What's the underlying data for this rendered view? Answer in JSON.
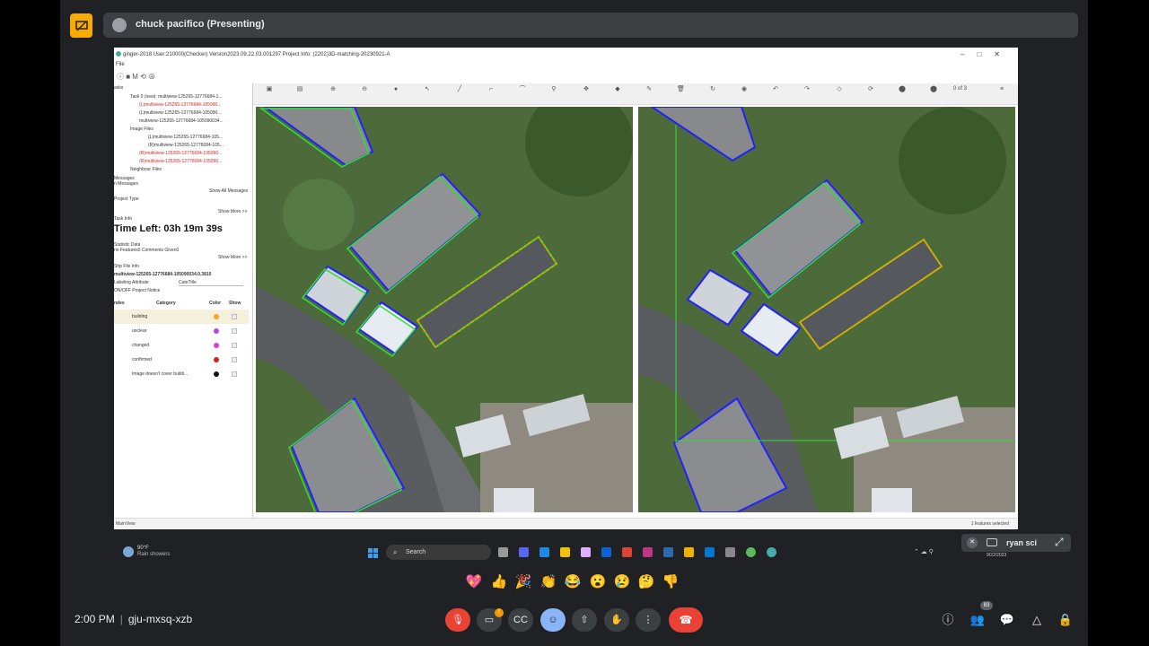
{
  "meet": {
    "presenter": "chuck pacifico (Presenting)",
    "time": "2:00 PM",
    "meeting_code": "gju-mxsq-xzb",
    "participant_count": "83",
    "pinned_participant": "ryan sci",
    "notification_count": "!",
    "reactions": [
      "💖",
      "👍",
      "🎉",
      "👏",
      "😂",
      "😮",
      "😢",
      "🤔",
      "👎"
    ]
  },
  "app": {
    "window_title": "ginger-2018   User:210000(Checker)   Version2023.09.22.03.001297   Project Info: (2202)3D-matching-20230921-A",
    "menu": "File",
    "page_count": "0 of 3",
    "status_left": "MainView",
    "status_right": "1 features selected",
    "left_panel": {
      "tasks_header": "asks",
      "task_items": [
        "Task 0 (new): multiview-125265-12776684-1...",
        "(L)multiview-125265-12776684-105090...",
        "(L)multiview-125265-12776684-105090...",
        "multiview-125265-12776684-105090034...",
        "Image Files",
        "(L)multiview-125265-12776684-105...",
        "(R)multiview-125265-12776684-105...",
        "(R)multiview-125265-12776684-105090...",
        "(R)multiview-125265-12776684-105090...",
        "Neighbour Files"
      ],
      "messages_label": "Messages",
      "messages_sub": "n Messages",
      "show_all_messages": "Show All Messages",
      "project_type": "Project Type",
      "show_more_1": "Show More >>",
      "task_info": "Task Info",
      "time_left": "Time Left: 03h 19m 39s",
      "statistic": "Statistic Data",
      "statistic_sub": "nn Features0 Comments Given0",
      "show_more_2": "Show More >>",
      "shp_info": "Shp File Info",
      "shp_file": "multiview-125265-12776684-105090034.0.3810",
      "labeling_attr": "Labeling Attribute",
      "attr_value": "CateTitle",
      "onoff_notice": "ON/OFF Project Notice",
      "columns": [
        "ndex",
        "Category",
        "Color",
        "Show"
      ],
      "labels": [
        {
          "category": "building",
          "color": "#f5a623"
        },
        {
          "category": "unclear",
          "color": "#b44be0"
        },
        {
          "category": "changed",
          "color": "#e63ad8"
        },
        {
          "category": "confirmed",
          "color": "#d42020"
        },
        {
          "category": "Image doesn't cover buildi...",
          "color": "#111111"
        }
      ]
    }
  },
  "taskbar": {
    "weather_temp": "90°F",
    "weather_desc": "Rain showers",
    "search_placeholder": "Search",
    "date": "9/22/2023"
  }
}
